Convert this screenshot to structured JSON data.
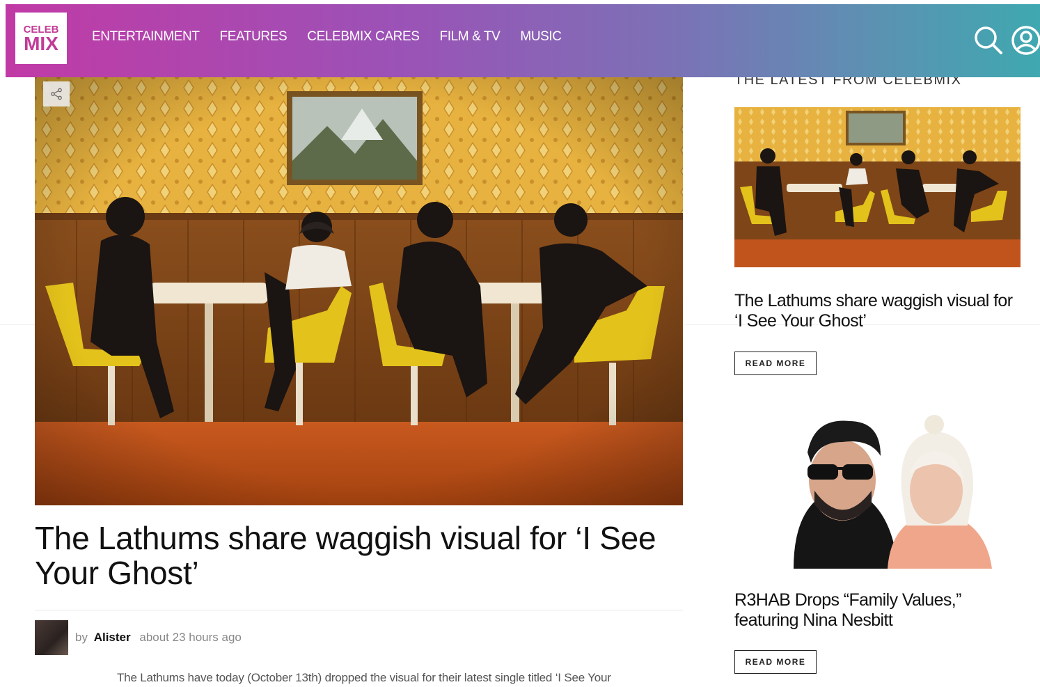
{
  "header": {
    "logo": {
      "top": "CELEB",
      "bottom": "MIX"
    },
    "nav": [
      "ENTERTAINMENT",
      "FEATURES",
      "CELEBMIX CARES",
      "FILM & TV",
      "MUSIC"
    ],
    "icons": [
      "search-icon",
      "user-account-icon"
    ]
  },
  "article": {
    "share_icon": "share-icon",
    "title": "The Lathums share waggish visual for ‘I See Your Ghost’",
    "byline_prefix": "by",
    "author": "Alister",
    "time": "about 23 hours ago",
    "excerpt": "The Lathums have today (October 13th) dropped the visual for their latest single titled ‘I See Your"
  },
  "sidebar": {
    "heading": "THE LATEST FROM CELEBMIX",
    "items": [
      {
        "title": "The Lathums share waggish visual for ‘I See Your Ghost’",
        "button": "READ MORE"
      },
      {
        "title": "R3HAB Drops “Family Values,” featuring Nina Nesbitt",
        "button": "READ MORE"
      }
    ]
  },
  "colors": {
    "header_gradient_start": "#c13aa6",
    "header_gradient_end": "#3fa8b0",
    "logo_pink": "#c23b96"
  }
}
